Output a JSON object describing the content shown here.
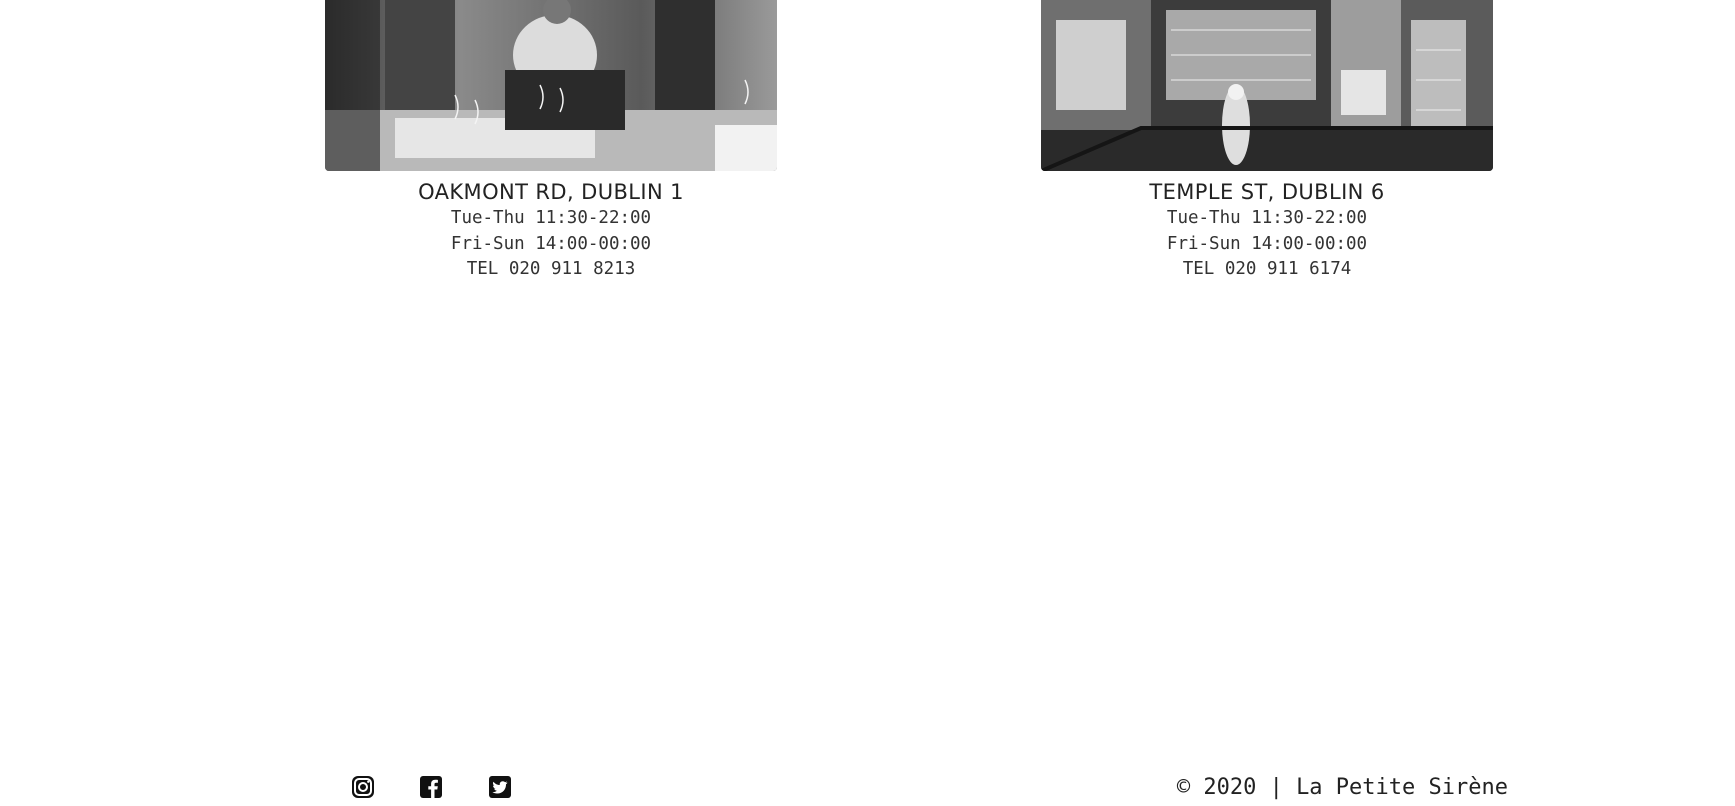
{
  "locations": [
    {
      "title": "OAKMONT RD, DUBLIN 1",
      "hours_weekday": "Tue-Thu 11:30-22:00",
      "hours_weekend": "Fri-Sun 14:00-00:00",
      "phone": "TEL 020 911 8213"
    },
    {
      "title": "TEMPLE ST, DUBLIN 6",
      "hours_weekday": "Tue-Thu 11:30-22:00",
      "hours_weekend": "Fri-Sun 14:00-00:00",
      "phone": "TEL 020 911 6174"
    }
  ],
  "footer": {
    "social": [
      "instagram-icon",
      "facebook-icon",
      "twitter-icon"
    ],
    "copyright": "© 2020 | La Petite Sirène"
  }
}
